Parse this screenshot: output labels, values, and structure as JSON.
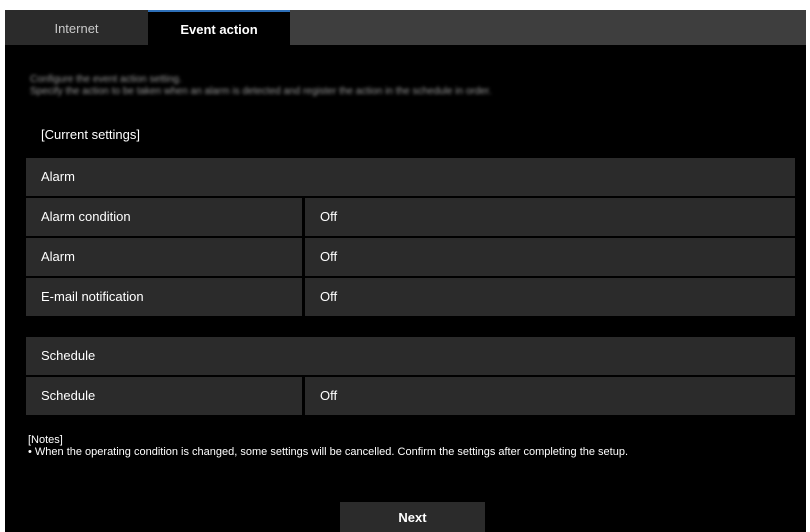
{
  "tabs": [
    {
      "label": "Internet"
    },
    {
      "label": "Event action"
    }
  ],
  "intro": {
    "line1": "Configure the event action setting.",
    "line2": "Specify the action to be taken when an alarm is detected and register the action in the schedule in order."
  },
  "current_settings_label": "[Current settings]",
  "alarm_section": {
    "title": "Alarm",
    "rows": [
      {
        "label": "Alarm condition",
        "value": "Off"
      },
      {
        "label": "Alarm",
        "value": "Off"
      },
      {
        "label": "E-mail notification",
        "value": "Off"
      }
    ]
  },
  "schedule_section": {
    "title": "Schedule",
    "rows": [
      {
        "label": "Schedule",
        "value": "Off"
      }
    ]
  },
  "notes": {
    "title": "[Notes]",
    "text": "• When the operating condition is changed, some settings will be cancelled. Confirm the settings after completing the setup."
  },
  "next_button": "Next",
  "colors": {
    "background": "#000000",
    "panel": "#2b2b2b",
    "tabbar": "#3e3e3e",
    "active_tab_accent": "#2d6fb8",
    "text": "#ffffff"
  }
}
